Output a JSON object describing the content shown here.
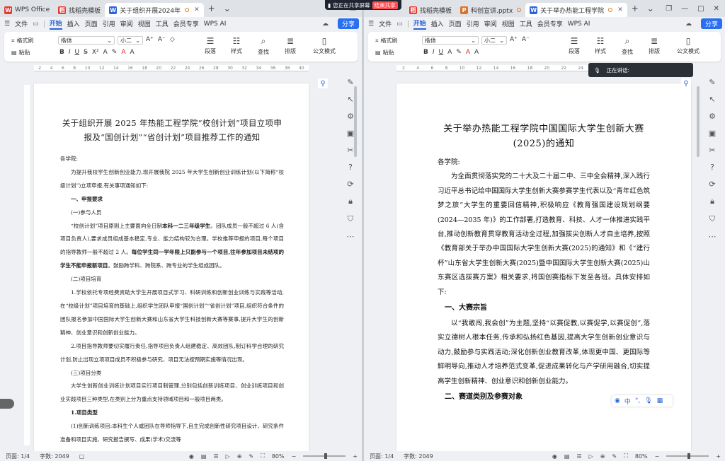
{
  "share_banner": {
    "text": "您正在共享屏幕",
    "end": "结束共享"
  },
  "voice_popup": {
    "text": "正在讲话:"
  },
  "left": {
    "tabs": [
      {
        "label": "WPS Office",
        "icon": "wps-logo",
        "color": "#e8372e"
      },
      {
        "label": "找稻壳模板",
        "icon": "template-icon",
        "color": "#e8372e"
      },
      {
        "label": "关于组织开展2024年",
        "icon": "word-icon",
        "color": "#2a64d8"
      }
    ],
    "menu": [
      "文件",
      "开始",
      "插入",
      "页面",
      "引用",
      "审阅",
      "视图",
      "工具",
      "会员专享",
      "WPS AI"
    ],
    "share_label": "分享",
    "ribbon": {
      "format_painter": "格式刷",
      "paste": "粘贴",
      "font": "楷体",
      "size": "小二",
      "paragraph": "段落",
      "style": "样式",
      "find": "查找",
      "layout": "排版",
      "official": "公文模式"
    },
    "doc": {
      "title": "关于组织开展 2025 年热能工程学院“校创计划”项目立项申报及“国创计划”“省创计划”项目推荐工作的通知",
      "greeting": "各学院:",
      "p1": "为提升我校学生创新创业能力,现开展我院 2025 年大学生创新创业训练计划(以下简称“校级计划”)立项申报,有关事项通知如下:",
      "h1": "一、申报要求",
      "h1a": "(一)参与人员",
      "p2_a": "“校创计划”项目原则上主要面向全日制",
      "p2_b": "本科一二三年级学生",
      "p2_c": "。团队成员一般不超过 6 人(含项目负责人),要求成员组成基本稳定,专业、能力结构较为合理。学校推荐申报的项目,每个项目的指导教师一般不超过 2 人。",
      "p2_d": "每位学生同一学年限上只能参与一个项目,往年参加项目未结项的学生不能申报新项目",
      "p2_e": "。鼓励跨学科、跨院系、跨专业的学生组成团队。",
      "h1b": "(二)项目培育",
      "p3": "1.学校依托专项经费资助大学生开展项目式学习、科研训练和创新创业训练与实践等活动,在“校级计划”项目培育的基础上,组织学生团队申报“国创计划”“省创计划”项目,组织符合条件的团队报名参加中国国际大学生创新大赛和山东省大学生科技创新大赛等赛事,提升大学生的创新精神、创业意识和创新创业能力。",
      "p4": "2.项目指导教师要切实履行责任,指导项目负责人组建稳定、高效团队,制订科学合理的研究计划,防止出现立项项目成员不积极参与研究、项目无法按预期实施等情况出现。",
      "h1c": "(三)项目分类",
      "p5": "大学生创新创业训练计划项目实行项目制管理,分别包括创新训练项目、创业训练项目和创业实践项目三种类型,在类别上分为重点支持领域项目和一般项目两类。",
      "h2": "1.项目类型",
      "p6": "(1)创新训练项目:本科生个人或团队在导师指导下,自主完成创新性研究项目设计、研究条件准备和项目实施、研究报告撰写、成果(学术)交流等"
    },
    "status": {
      "page": "页面: 1/4",
      "words": "字数: 2049",
      "zoom": "80%"
    }
  },
  "right": {
    "tabs": [
      {
        "label": "找稻壳模板",
        "icon": "template-icon",
        "color": "#e8372e"
      },
      {
        "label": "科创宣讲.pptx",
        "icon": "ppt-icon",
        "color": "#e0712b"
      },
      {
        "label": "关于举办热能工程学院",
        "icon": "word-icon",
        "color": "#2a64d8"
      }
    ],
    "menu": [
      "文件",
      "开始",
      "插入",
      "页面",
      "引用",
      "审阅",
      "视图",
      "工具",
      "会员专享",
      "WPS AI"
    ],
    "share_label": "分享",
    "ribbon": {
      "format_painter": "格式刷",
      "paste": "粘贴",
      "font": "楷体",
      "size": "小二",
      "paragraph": "段落",
      "style": "样式",
      "find": "查找",
      "layout": "排版",
      "official": "公文模式"
    },
    "doc": {
      "title": "关于举办热能工程学院中国国际大学生创新大赛(2025)的通知",
      "greeting": "各学院:",
      "p1": "为全面贯彻落实党的二十大及二十届二中、三中全会精神,深入践行习近平总书记给中国国际大学生创新大赛参赛学生代表以及“青年红色筑梦之旅”大学生的重要回信精神,积极响应《教育强国建设规划纲要(2024—2035 年)》的工作部署,打造教育、科技、人才一体推进实践平台,推动创新教育贯穿教育活动全过程,加强拔尖创新人才自主培养,按照《教育部关于举办中国国际大学生创新大赛(2025)的通知》和《“建行杯”山东省大学生创新大赛(2025)暨中国国际大学生创新大赛(2025)山东赛区选拔赛方案》相关要求,将国创赛指标下发至各班。具体安排如下:",
      "h1": "一、大赛宗旨",
      "p2": "以“我敢闯,我会创”为主题,坚持“以赛促教,以赛促学,以赛促创”,落实立德树人根本任务,传承和弘扬红色基因,提高大学生创新创业意识与动力,鼓励参与实践活动;深化创新创业教育改革,体现更中国、更国际等鲜明导向,推动人才培养范式变革,促进成果转化与产学研用融合,切实提高学生创新精神、创业意识和创新创业能力。",
      "h2": "二、赛道类别及参赛对象"
    },
    "status": {
      "page": "页面: 1/4",
      "words": "字数: 2049",
      "zoom": "80%"
    },
    "ime": "中"
  }
}
